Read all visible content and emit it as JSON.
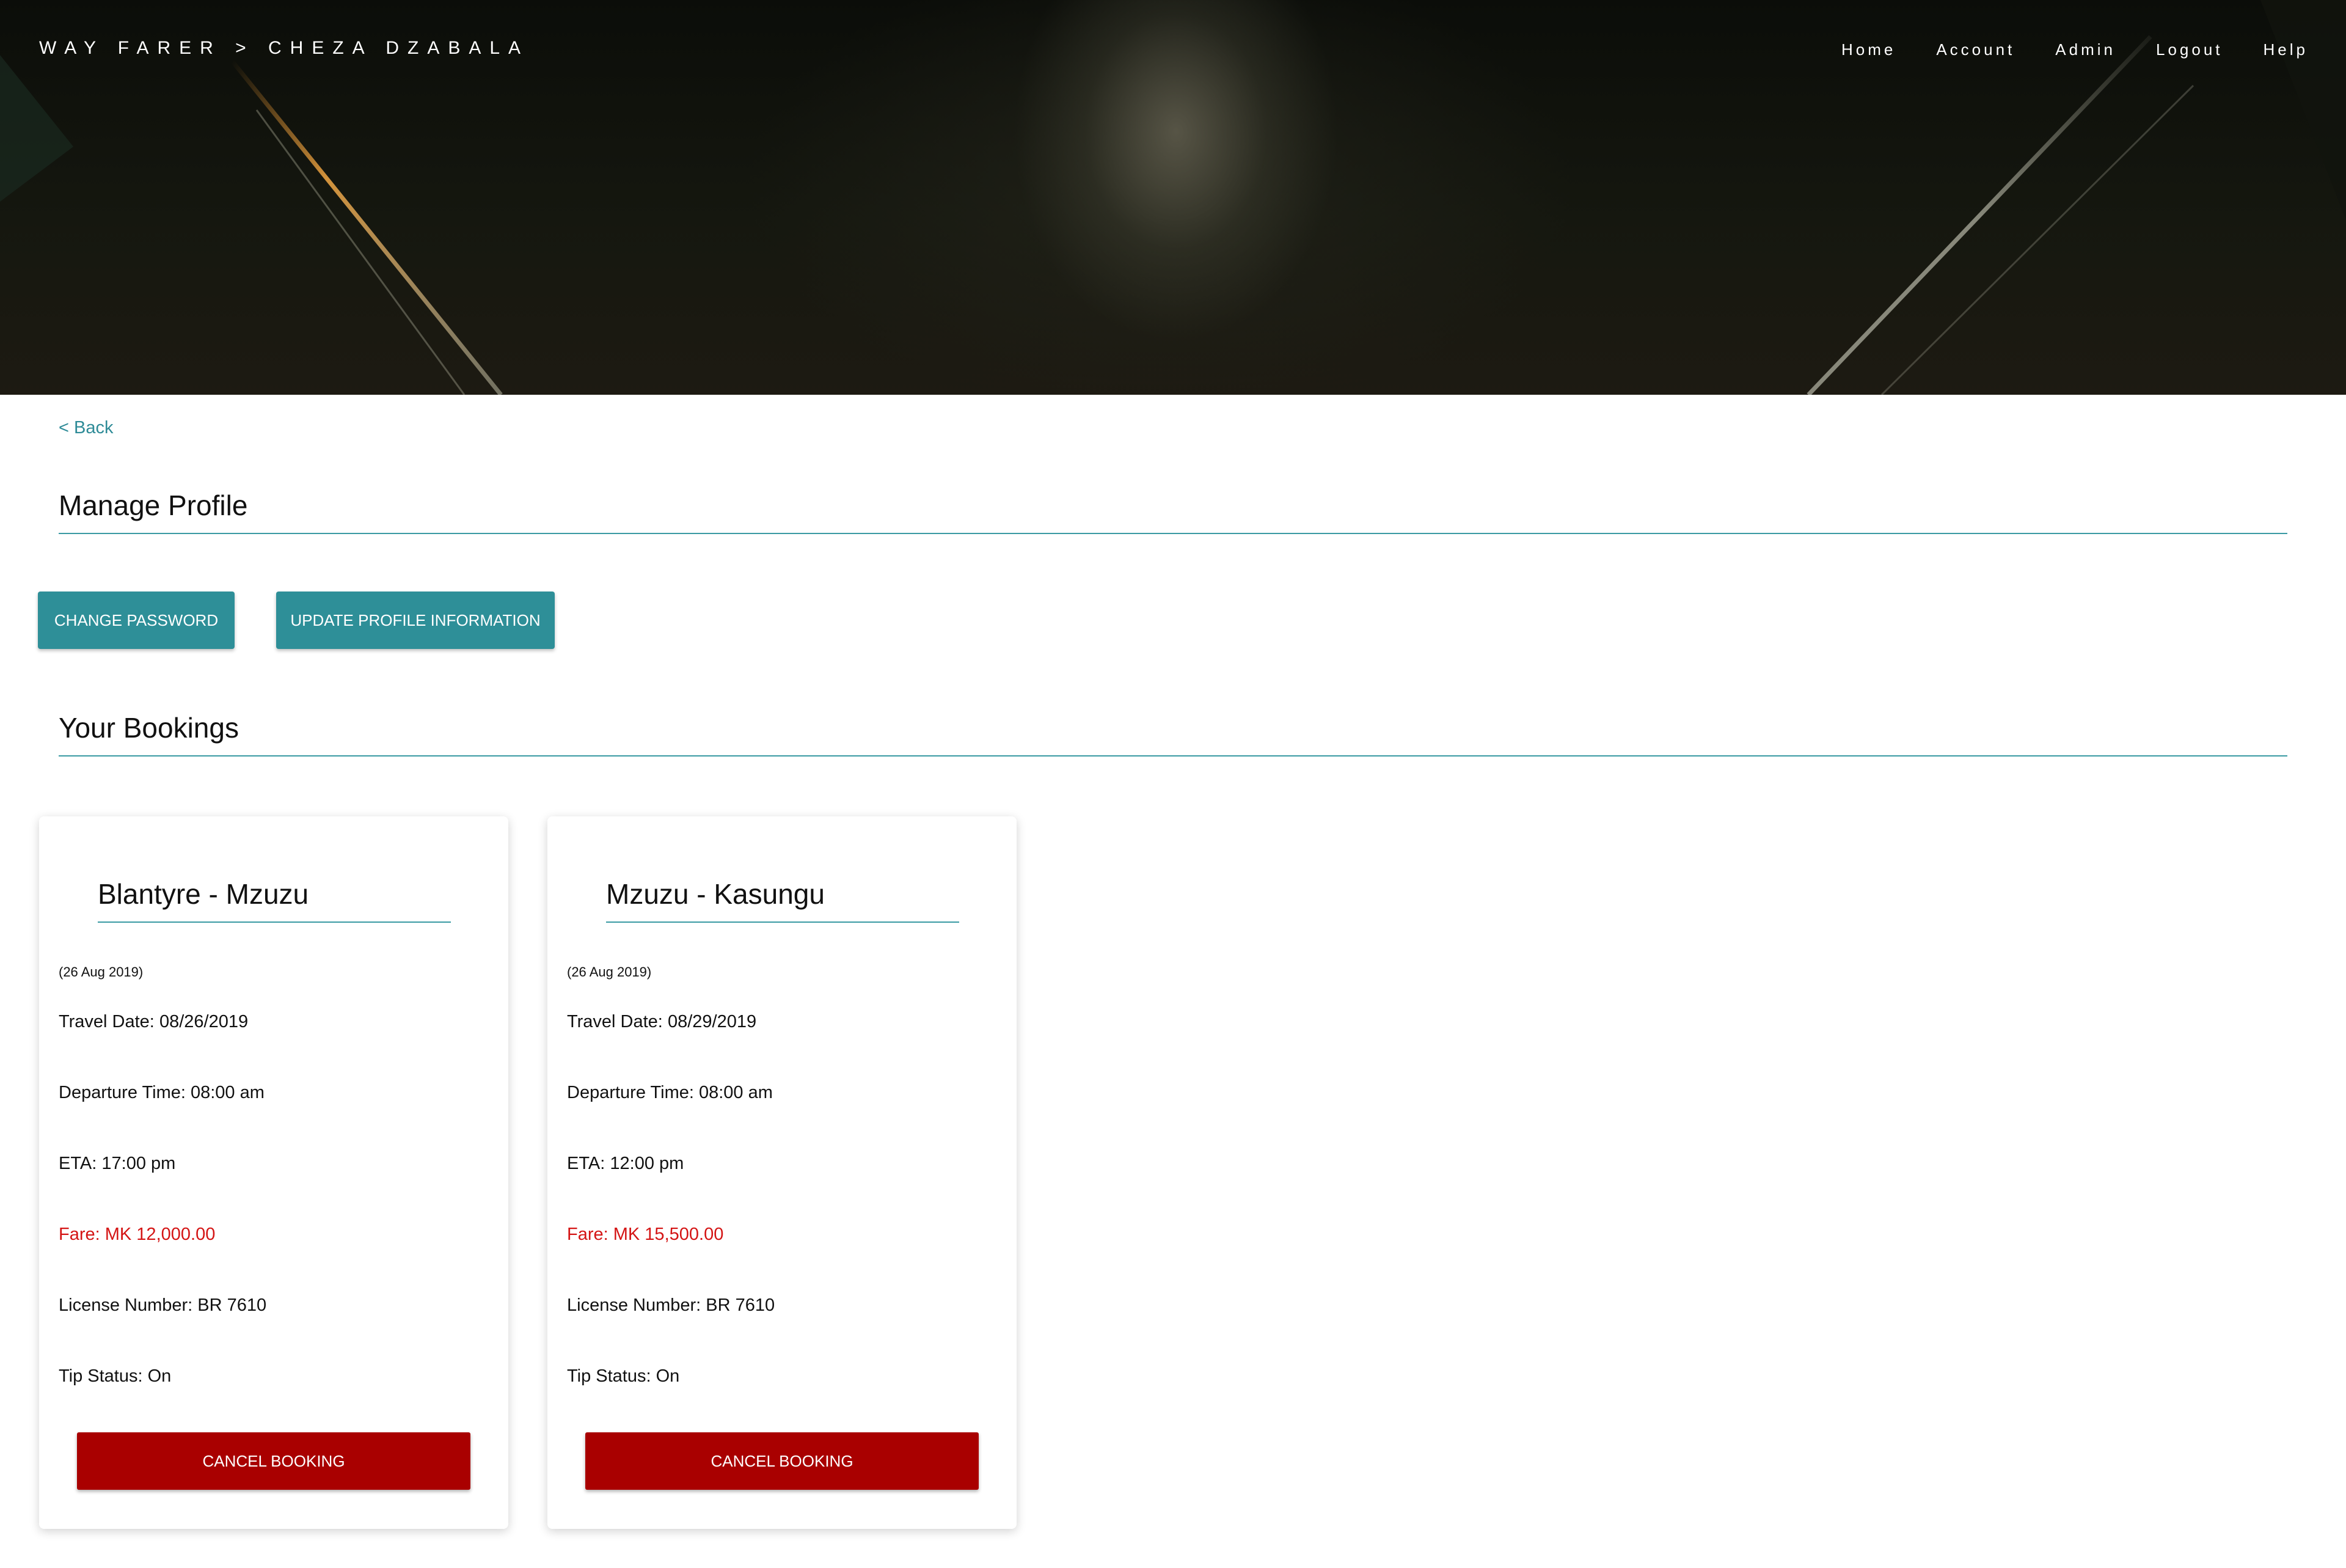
{
  "header": {
    "brand": "WAY FARER > CHEZA DZABALA",
    "nav": [
      "Home",
      "Account",
      "Admin",
      "Logout",
      "Help"
    ]
  },
  "main": {
    "back_label": "< Back",
    "profile_title": "Manage Profile",
    "buttons": {
      "change_password": "CHANGE PASSWORD",
      "update_profile": "UPDATE PROFILE INFORMATION"
    },
    "bookings_title": "Your Bookings"
  },
  "labels": {
    "travel_date": "Travel Date:",
    "departure_time": "Departure Time:",
    "eta": "ETA:",
    "fare": "Fare:",
    "license_number": "License Number:",
    "tip_status": "Tip Status:"
  },
  "bookings": [
    {
      "route": "Blantyre - Mzuzu",
      "booked_on": "(26 Aug 2019)",
      "travel_date": "08/26/2019",
      "departure_time": "08:00 am",
      "eta": "17:00 pm",
      "fare": "MK 12,000.00",
      "license_number": "BR 7610",
      "tip_status": "On",
      "cancel_label": "CANCEL BOOKING"
    },
    {
      "route": "Mzuzu - Kasungu",
      "booked_on": "(26 Aug 2019)",
      "travel_date": "08/29/2019",
      "departure_time": "08:00 am",
      "eta": "12:00 pm",
      "fare": "MK 15,500.00",
      "license_number": "BR 7610",
      "tip_status": "On",
      "cancel_label": "CANCEL BOOKING"
    }
  ],
  "colors": {
    "accent": "#2e8f98",
    "danger": "#a90000",
    "fare": "#d41414"
  }
}
